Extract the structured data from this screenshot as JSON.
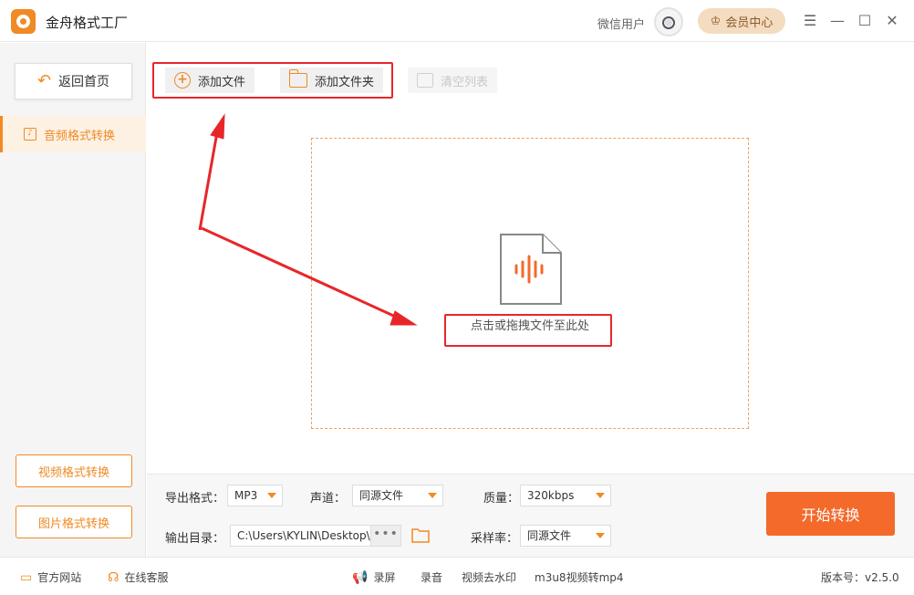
{
  "app": {
    "title": "金舟格式工厂"
  },
  "user": {
    "name": "微信用户",
    "vip_label": "会员中心"
  },
  "window": {
    "menu": "☰",
    "minimize": "—",
    "maximize": "☐",
    "close": "✕"
  },
  "sidebar": {
    "back_label": "返回首页",
    "active_item": "音频格式转换",
    "video_label": "视频格式转换",
    "image_label": "图片格式转换"
  },
  "toolbar": {
    "add_file": "添加文件",
    "add_folder": "添加文件夹",
    "clear_list": "清空列表"
  },
  "dropzone": {
    "text": "点击或拖拽文件至此处"
  },
  "settings": {
    "format_label": "导出格式：",
    "format_value": "MP3",
    "channel_label": "声道：",
    "channel_value": "同源文件",
    "quality_label": "质量：",
    "quality_value": "320kbps",
    "output_label": "输出目录：",
    "output_path": "C:\\Users\\KYLIN\\Desktop\\",
    "browse": "•••",
    "samplerate_label": "采样率：",
    "samplerate_value": "同源文件"
  },
  "start_button": "开始转换",
  "footer": {
    "website": "官方网站",
    "service": "在线客服",
    "record_screen": "录屏",
    "record_audio": "录音",
    "watermark": "视频去水印",
    "m3u8": "m3u8视频转mp4",
    "version": "版本号：v2.5.0"
  },
  "colors": {
    "accent": "#f08a24",
    "start": "#f36a2b",
    "annotation": "#e8262a"
  },
  "icons": [
    "logo-icon",
    "avatar-icon",
    "crown-icon",
    "menu-icon",
    "minimize-icon",
    "maximize-icon",
    "close-icon",
    "back-arrow-icon",
    "music-note-icon",
    "plus-circle-icon",
    "folder-icon",
    "basket-icon",
    "audio-file-icon",
    "monitor-icon",
    "headset-icon",
    "megaphone-icon"
  ]
}
